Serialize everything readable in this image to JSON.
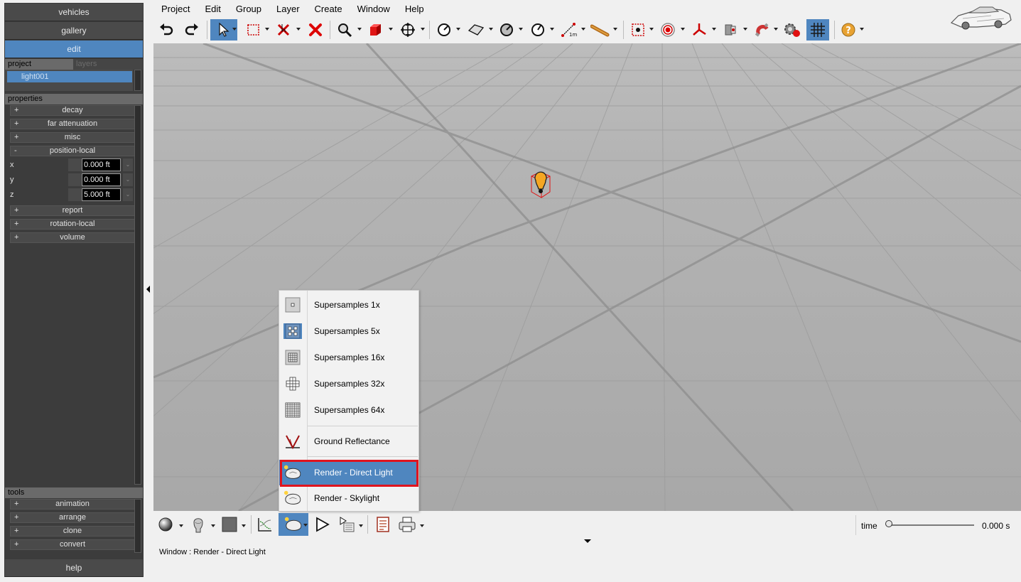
{
  "nav": {
    "vehicles": "vehicles",
    "gallery": "gallery",
    "edit": "edit",
    "help": "help"
  },
  "project_tabs": {
    "project": "project",
    "layers": "layers"
  },
  "project_items": [
    "light001"
  ],
  "properties": {
    "header": "properties",
    "groups": {
      "decay": "decay",
      "far_attenuation": "far attenuation",
      "misc": "misc",
      "position_local": "position-local",
      "report": "report",
      "rotation_local": "rotation-local",
      "volume": "volume"
    },
    "expand_symbol": "+",
    "collapse_symbol": "-",
    "position": {
      "x_label": "x",
      "x_value": "0.000 ft",
      "y_label": "y",
      "y_value": "0.000 ft",
      "z_label": "z",
      "z_value": "5.000 ft"
    }
  },
  "tools": {
    "header": "tools",
    "groups": {
      "animation": "animation",
      "arrange": "arrange",
      "clone": "clone",
      "convert": "convert"
    }
  },
  "menubar": {
    "project": "Project",
    "edit": "Edit",
    "group": "Group",
    "layer": "Layer",
    "create": "Create",
    "window": "Window",
    "help": "Help"
  },
  "toolbar_icons": [
    "undo-icon",
    "redo-icon",
    "select-arrow-icon",
    "region-select-icon",
    "delete-selection-icon",
    "delete-icon",
    "zoom-icon",
    "create-box-icon",
    "move-icon",
    "dimension-icon",
    "surface-icon",
    "angle-icon",
    "radius-icon",
    "measure-1m-icon",
    "ruler-icon",
    "snap-point-icon",
    "target-icon",
    "axes-icon",
    "clip-icon",
    "magnet-icon",
    "settings-icon",
    "grid-icon",
    "help-icon"
  ],
  "popup": {
    "items": {
      "ss1": "Supersamples 1x",
      "ss5": "Supersamples 5x",
      "ss16": "Supersamples 16x",
      "ss32": "Supersamples 32x",
      "ss64": "Supersamples 64x",
      "ground": "Ground Reflectance",
      "direct": "Render - Direct Light",
      "skylight": "Render - Skylight"
    }
  },
  "time": {
    "label": "time",
    "value": "0.000 s",
    "position": 0
  },
  "status_text": "Window : Render - Direct Light",
  "colors": {
    "accent": "#4f86bf",
    "panel_bg": "#3c3c3c",
    "viewport_bg": "#a9a9a9",
    "highlight_border": "#e0141e",
    "light_bulb": "#f5a623"
  }
}
